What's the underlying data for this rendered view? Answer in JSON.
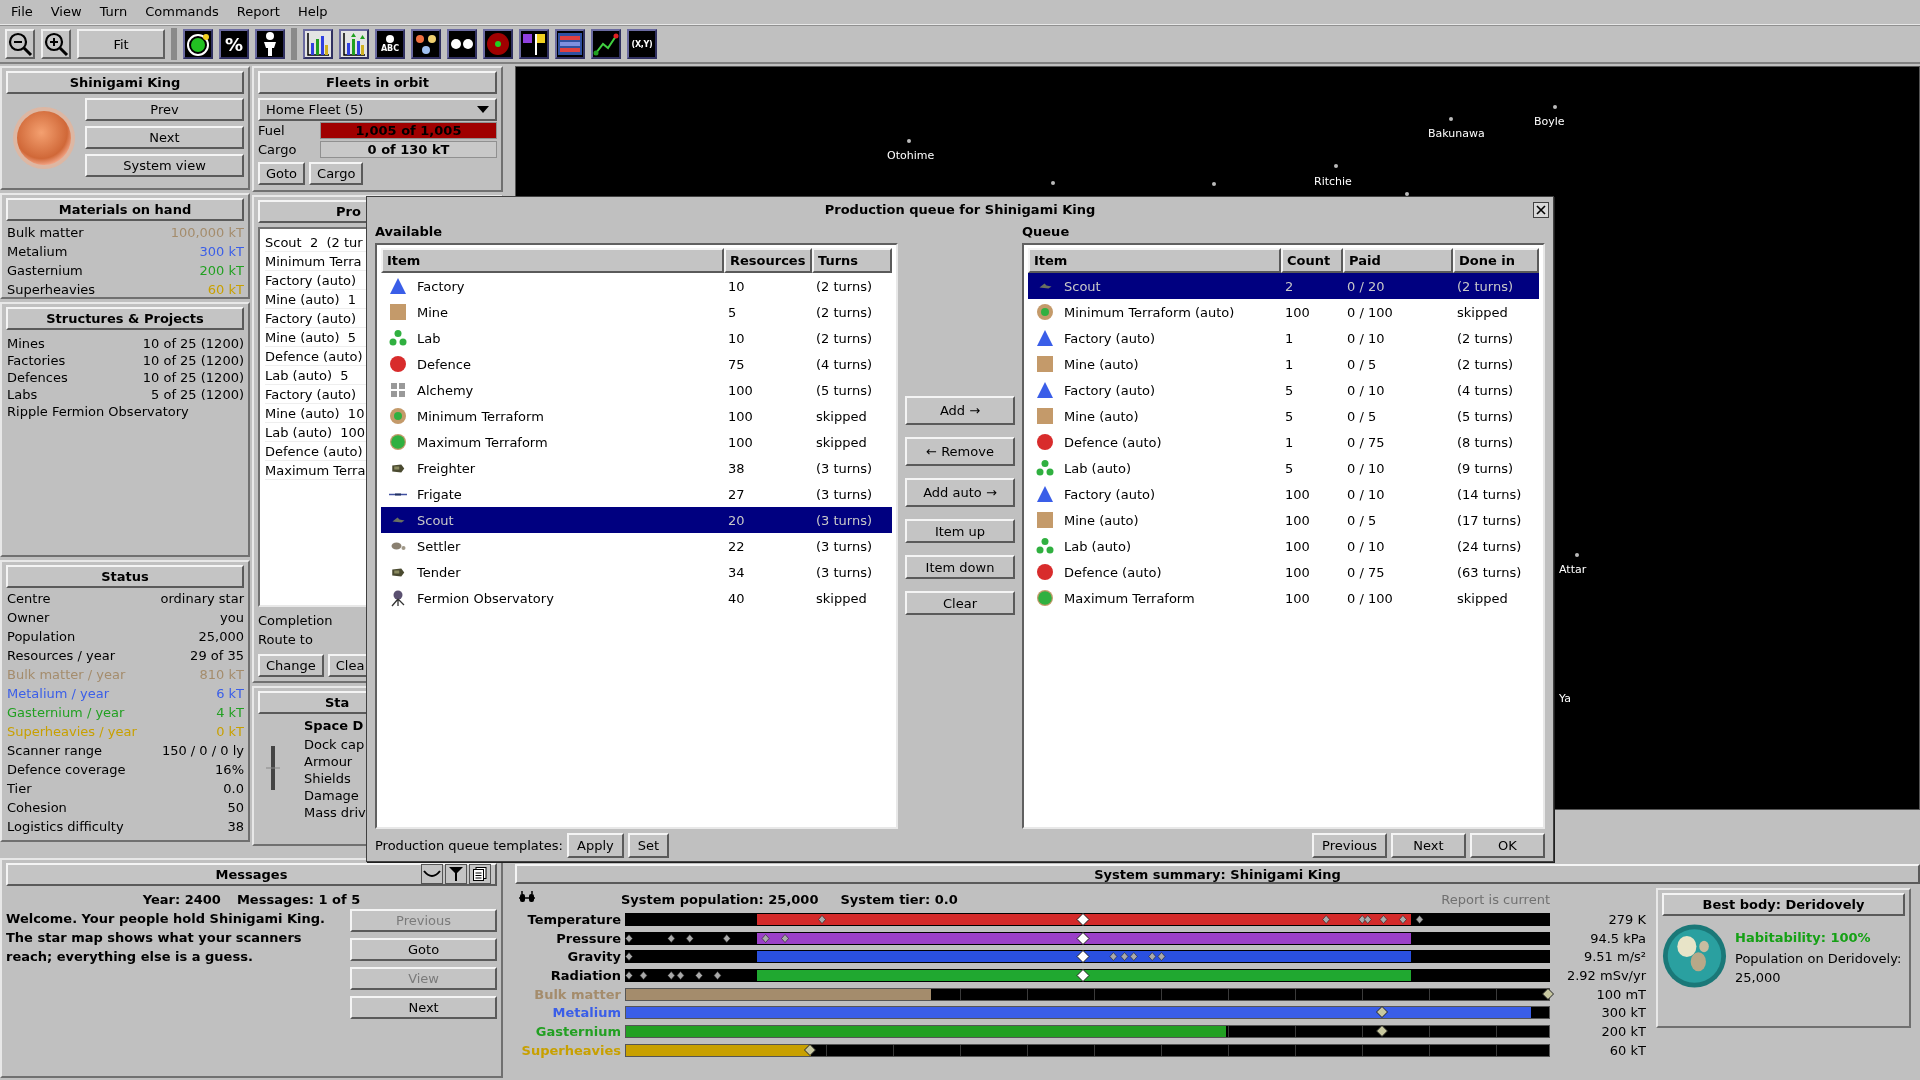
{
  "menu": [
    "File",
    "View",
    "Turn",
    "Commands",
    "Report",
    "Help"
  ],
  "toolbar": [
    [
      {
        "kind": "zoom-out"
      },
      {
        "kind": "zoom-in"
      },
      {
        "kind": "fit",
        "label": "Fit"
      }
    ],
    [
      {
        "kind": "orbit"
      },
      {
        "kind": "percent",
        "label": "%"
      },
      {
        "kind": "person"
      }
    ],
    [
      {
        "kind": "bars"
      },
      {
        "kind": "bars-arrows"
      },
      {
        "kind": "abc",
        "label": "ABC"
      },
      {
        "kind": "dots3"
      },
      {
        "kind": "dots2"
      },
      {
        "kind": "target"
      },
      {
        "kind": "flags"
      },
      {
        "kind": "list"
      },
      {
        "kind": "line"
      },
      {
        "kind": "xy",
        "label": "(X,Y)"
      }
    ]
  ],
  "system": {
    "name": "Shinigami King",
    "buttons": [
      "Prev",
      "Next",
      "System view"
    ]
  },
  "materials": {
    "title": "Materials on hand",
    "items": [
      {
        "name": "Bulk matter",
        "value": "100,000 kT",
        "color": "#a48c6c"
      },
      {
        "name": "Metalium",
        "value": "300 kT",
        "color": "#3a5ee8"
      },
      {
        "name": "Gasternium",
        "value": "200 kT",
        "color": "#22a022"
      },
      {
        "name": "Superheavies",
        "value": "60 kT",
        "color": "#c8a000"
      }
    ]
  },
  "structures": {
    "title": "Structures & Projects",
    "items": [
      {
        "name": "Mines",
        "value": "10 of 25 (1200)"
      },
      {
        "name": "Factories",
        "value": "10 of 25 (1200)"
      },
      {
        "name": "Defences",
        "value": "10 of 25 (1200)"
      },
      {
        "name": "Labs",
        "value": "5 of 25 (1200)"
      },
      {
        "name": "Ripple Fermion Observatory"
      }
    ]
  },
  "status": {
    "title": "Status",
    "items": [
      {
        "name": "Centre",
        "value": "ordinary star",
        "color": "#000000"
      },
      {
        "name": "Owner",
        "value": "you",
        "color": "#000000"
      },
      {
        "name": "Population",
        "value": "25,000",
        "color": "#000000"
      },
      {
        "name": "Resources / year",
        "value": "29 of 35",
        "color": "#000000"
      },
      {
        "name": "Bulk matter / year",
        "value": "810 kT",
        "color": "#a48c6c"
      },
      {
        "name": "Metalium / year",
        "value": "6 kT",
        "color": "#3a5ee8"
      },
      {
        "name": "Gasternium / year",
        "value": "4 kT",
        "color": "#22a022"
      },
      {
        "name": "Superheavies / year",
        "value": "0 kT",
        "color": "#c8a000"
      },
      {
        "name": "Scanner range",
        "value": "150 / 0 / 0 ly",
        "color": "#000000"
      },
      {
        "name": "Defence coverage",
        "value": "16%",
        "color": "#000000"
      },
      {
        "name": "Tier",
        "value": "0.0",
        "color": "#000000"
      },
      {
        "name": "Cohesion",
        "value": "50",
        "color": "#000000"
      },
      {
        "name": "Logistics difficulty",
        "value": "38",
        "color": "#000000"
      }
    ]
  },
  "fleets": {
    "title": "Fleets in orbit",
    "fleet": "Home Fleet (5)",
    "fuel_label": "Fuel",
    "fuel": {
      "reading": "1,005 of 1,005",
      "level": 1
    },
    "cargo_label": "Cargo",
    "cargo": {
      "reading": "0 of 130 kT"
    },
    "buttons": [
      "Goto",
      "Cargo"
    ]
  },
  "production": {
    "title": "Pro",
    "items": [
      "Scout  2  (2 tur",
      "Minimum Terra",
      "Factory (auto)",
      "Mine (auto)  1",
      "Factory (auto)",
      "Mine (auto)  5",
      "Defence (auto)",
      "Lab (auto)  5",
      "Factory (auto)",
      "Mine (auto)  10",
      "Lab (auto)  100",
      "Defence (auto)",
      "Maximum Terra"
    ],
    "labels": [
      "Completion",
      "Route to"
    ],
    "buttons": [
      "Change",
      "Clea"
    ]
  },
  "starbase": {
    "title": "Sta",
    "heading": "Space D",
    "rows": [
      "Dock cap",
      "Armour",
      "Shields",
      "Damage",
      "Mass driv"
    ]
  },
  "map": {
    "stars": [
      {
        "label": "Otohime"
      },
      {
        "label": "Ritchie"
      },
      {
        "label": "Bakunawa"
      },
      {
        "label": "Boyle"
      },
      {
        "label": "Attar"
      },
      {
        "label": "Ya"
      }
    ]
  },
  "dialog": {
    "title": "Production queue for Shinigami King",
    "available": {
      "label": "Available",
      "columns": [
        "Item",
        "Resources",
        "Turns"
      ],
      "rows": [
        {
          "kind": "factory",
          "item": "Factory",
          "resources": "10",
          "turns": "(2 turns)",
          "selected": false
        },
        {
          "kind": "mine",
          "item": "Mine",
          "resources": "5",
          "turns": "(2 turns)",
          "selected": false
        },
        {
          "kind": "lab",
          "item": "Lab",
          "resources": "10",
          "turns": "(2 turns)",
          "selected": false
        },
        {
          "kind": "defence",
          "item": "Defence",
          "resources": "75",
          "turns": "(4 turns)",
          "selected": false
        },
        {
          "kind": "alchemy",
          "item": "Alchemy",
          "resources": "100",
          "turns": "(5 turns)",
          "selected": false
        },
        {
          "kind": "min-terraform",
          "item": "Minimum Terraform",
          "resources": "100",
          "turns": "skipped",
          "selected": false
        },
        {
          "kind": "max-terraform",
          "item": "Maximum Terraform",
          "resources": "100",
          "turns": "skipped",
          "selected": false
        },
        {
          "kind": "freighter",
          "item": "Freighter",
          "resources": "38",
          "turns": "(3 turns)",
          "selected": false
        },
        {
          "kind": "frigate",
          "item": "Frigate",
          "resources": "27",
          "turns": "(3 turns)",
          "selected": false
        },
        {
          "kind": "scout",
          "item": "Scout",
          "resources": "20",
          "turns": "(3 turns)",
          "selected": true
        },
        {
          "kind": "settler",
          "item": "Settler",
          "resources": "22",
          "turns": "(3 turns)",
          "selected": false
        },
        {
          "kind": "tender",
          "item": "Tender",
          "resources": "34",
          "turns": "(3 turns)",
          "selected": false
        },
        {
          "kind": "observatory",
          "item": "Fermion Observatory",
          "resources": "40",
          "turns": "skipped",
          "selected": false
        }
      ]
    },
    "actions": [
      {
        "label": "Add →",
        "kind": "arrow"
      },
      {
        "label": "← Remove",
        "kind": "arrow"
      },
      {
        "label": "Add auto →",
        "kind": "arrow"
      },
      {
        "label": "Item up",
        "kind": "plain"
      },
      {
        "label": "Item down",
        "kind": "plain"
      },
      {
        "label": "Clear",
        "kind": "plain"
      }
    ],
    "queue": {
      "label": "Queue",
      "columns": [
        "Item",
        "Count",
        "Paid",
        "Done in"
      ],
      "rows": [
        {
          "kind": "scout",
          "item": "Scout",
          "count": "2",
          "paid": "0 / 20",
          "done": "(2 turns)",
          "selected": true
        },
        {
          "kind": "min-terraform",
          "item": "Minimum Terraform (auto)",
          "count": "100",
          "paid": "0 / 100",
          "done": "skipped",
          "selected": false
        },
        {
          "kind": "factory",
          "item": "Factory (auto)",
          "count": "1",
          "paid": "0 / 10",
          "done": "(2 turns)",
          "selected": false
        },
        {
          "kind": "mine",
          "item": "Mine (auto)",
          "count": "1",
          "paid": "0 / 5",
          "done": "(2 turns)",
          "selected": false
        },
        {
          "kind": "factory",
          "item": "Factory (auto)",
          "count": "5",
          "paid": "0 / 10",
          "done": "(4 turns)",
          "selected": false
        },
        {
          "kind": "mine",
          "item": "Mine (auto)",
          "count": "5",
          "paid": "0 / 5",
          "done": "(5 turns)",
          "selected": false
        },
        {
          "kind": "defence",
          "item": "Defence (auto)",
          "count": "1",
          "paid": "0 / 75",
          "done": "(8 turns)",
          "selected": false
        },
        {
          "kind": "lab",
          "item": "Lab (auto)",
          "count": "5",
          "paid": "0 / 10",
          "done": "(9 turns)",
          "selected": false
        },
        {
          "kind": "factory",
          "item": "Factory (auto)",
          "count": "100",
          "paid": "0 / 10",
          "done": "(14 turns)",
          "selected": false
        },
        {
          "kind": "mine",
          "item": "Mine (auto)",
          "count": "100",
          "paid": "0 / 5",
          "done": "(17 turns)",
          "selected": false
        },
        {
          "kind": "lab",
          "item": "Lab (auto)",
          "count": "100",
          "paid": "0 / 10",
          "done": "(24 turns)",
          "selected": false
        },
        {
          "kind": "defence",
          "item": "Defence (auto)",
          "count": "100",
          "paid": "0 / 75",
          "done": "(63 turns)",
          "selected": false
        },
        {
          "kind": "max-terraform",
          "item": "Maximum Terraform",
          "count": "100",
          "paid": "0 / 100",
          "done": "skipped",
          "selected": false
        }
      ]
    },
    "templates_label": "Production queue templates:",
    "template_buttons": [
      "Apply",
      "Set"
    ],
    "buttons": [
      "Previous",
      "Next",
      "OK"
    ]
  },
  "messages": {
    "title": "Messages",
    "year": "Year: 2400",
    "count": "Messages: 1 of 5",
    "text": "Welcome. Your people hold Shinigami King. The star map shows what your scanners reach; everything else is a guess.",
    "buttons": [
      {
        "label": "Previous",
        "disabled": true
      },
      {
        "label": "Goto",
        "disabled": false
      },
      {
        "label": "View",
        "disabled": true
      },
      {
        "label": "Next",
        "disabled": false
      }
    ]
  },
  "summary": {
    "title": "System summary: Shinigami King",
    "population": "System population: 25,000",
    "tier": "System tier: 0.0",
    "report": "Report is current",
    "environment": [
      {
        "name": "Temperature",
        "value": "279 K",
        "color": "#d42a2a"
      },
      {
        "name": "Pressure",
        "value": "94.5 kPa",
        "color": "#9b40c8"
      },
      {
        "name": "Gravity",
        "value": "9.51 m/s²",
        "color": "#2a50e0"
      },
      {
        "name": "Radiation",
        "value": "2.92 mSv/yr",
        "color": "#20a830"
      }
    ],
    "resources": [
      {
        "name": "Bulk matter",
        "value": "100 mT",
        "color": "#a48c6c",
        "level": 0.33
      },
      {
        "name": "Metalium",
        "value": "300 kT",
        "color": "#3a5ee8",
        "level": 0.98
      },
      {
        "name": "Gasternium",
        "value": "200 kT",
        "color": "#22a022",
        "level": 0.65
      },
      {
        "name": "Superheavies",
        "value": "60 kT",
        "color": "#c8a000",
        "level": 0.2
      }
    ],
    "best_body": {
      "title": "Best body: Deridovely",
      "habitability": "Habitability: 100%",
      "population": "Population on Deridovely: 25,000"
    }
  }
}
